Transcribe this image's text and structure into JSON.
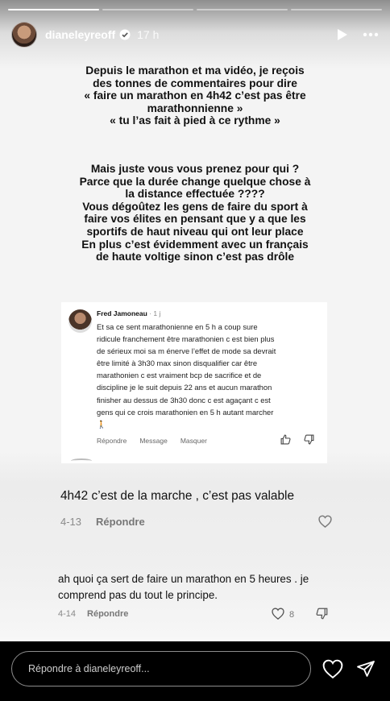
{
  "header": {
    "username": "dianeleyreoff",
    "time": "17 h"
  },
  "progress": {
    "segments": 4,
    "current": 1
  },
  "story_text": {
    "paragraph1": "Depuis le marathon et ma vidéo, je reçois\ndes tonnes de commentaires pour dire\n« faire un marathon en 4h42 c’est pas être\nmarathonnienne »\n« tu l’as fait à pied à ce rythme »",
    "paragraph2": "Mais juste vous vous prenez pour qui ?\nParce que la durée change quelque chose à\nla distance effectuée ????\nVous dégoûtez les gens de faire du sport à\nfaire vos élites en pensant que y a que les\nsportifs de haut niveau qui ont leur place\nEn plus c’est évidemment avec un français\nde haute voltige sinon c’est pas drôle"
  },
  "quoted_comment": {
    "author": "Fred Jamoneau",
    "age": "· 1 j",
    "text": "Et sa ce sent marathonienne en 5 h a coup sure\nridicule franchement être marathonien c est bien plus\nde sérieux moi sa m énerve l’effet de mode sa devrait\nêtre limité à 3h30 max sinon disqualifier car être\nmarathonien c est vraiment bcp de sacrifice et de\ndiscipline je le suit depuis 22 ans et aucun marathon\nfinisher au dessus de 3h30 donc c est agaçant c est\ngens qui ce crois marathonien en 5 h autant marcher\n🚶",
    "actions": [
      "Répondre",
      "Message",
      "Masquer"
    ]
  },
  "reply1": {
    "text": "4h42 c’est de la marche , c’est pas valable",
    "date": "4-13",
    "reply_label": "Répondre"
  },
  "reply2": {
    "text": "ah quoi ça sert de faire un marathon en 5 heures . je comprend pas du tout le principe.",
    "date": "4-14",
    "reply_label": "Répondre",
    "likes": "8"
  },
  "bottom": {
    "placeholder": "Répondre à dianeleyreoff..."
  },
  "icons": {
    "verified": "verified-badge-icon",
    "play": "play-icon",
    "more": "more-icon",
    "heart": "heart-icon",
    "send": "send-icon",
    "thumbs_up": "thumbs-up-icon",
    "thumbs_down": "thumbs-down-icon"
  }
}
